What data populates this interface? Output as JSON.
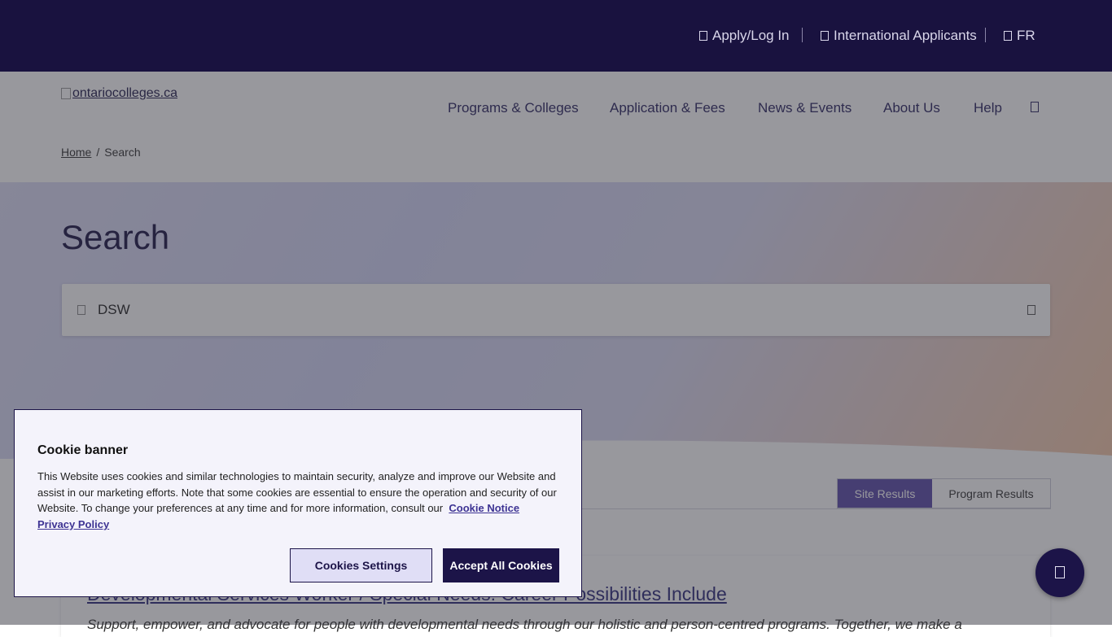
{
  "topbar": {
    "apply_login": "Apply/Log In",
    "international": "International Applicants",
    "language": "FR"
  },
  "header": {
    "logo_alt": "ontariocolleges.ca",
    "nav": [
      "Programs & Colleges",
      "Application & Fees",
      "News & Events",
      "About Us",
      "Help"
    ]
  },
  "breadcrumb": {
    "home": "Home",
    "separator": "/",
    "current": "Search"
  },
  "main": {
    "title": "Search",
    "search_value": "DSW",
    "tabs": {
      "site": "Site Results",
      "program": "Program Results"
    },
    "result": {
      "title": "Developmental Services Worker / Special Needs: Career Possibilities Include",
      "description": "Support, empower, and advocate for people with developmental needs through our holistic and person-centred programs. Together, we make a"
    }
  },
  "cookie_banner": {
    "title": "Cookie banner",
    "text": "This Website uses cookies and similar technologies to maintain security, analyze and improve our Website and assist in our marketing efforts. Note that some cookies are essential to ensure the operation and security of our Website. To change your preferences at any time and for more information, consult our",
    "cookie_notice_link": "Cookie Notice",
    "privacy_link": "Privacy Policy",
    "settings_button": "Cookies Settings",
    "accept_button": "Accept All Cookies"
  },
  "icons": {
    "apply": "user-icon",
    "international": "globe-icon",
    "language": "language-icon",
    "nav_search": "search-icon",
    "search_field": "search-icon",
    "clear": "close-icon",
    "chat": "chat-icon"
  },
  "colors": {
    "topbar": "#19123f",
    "accent": "#1c1448",
    "tab_active": "#5b4aa8"
  }
}
